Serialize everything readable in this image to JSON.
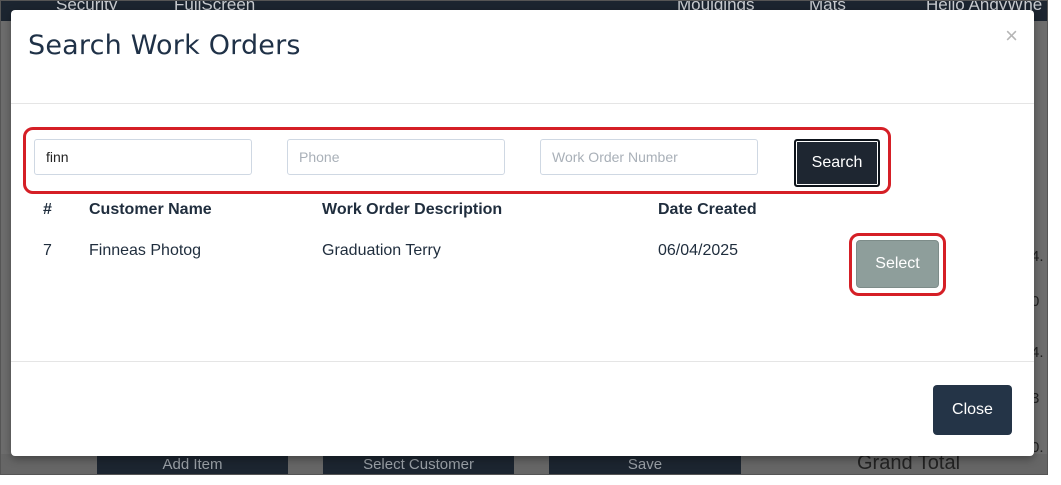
{
  "background": {
    "topbar_items": [
      "Security",
      "FullScreen",
      "Mouldings",
      "Mats",
      "Hello AndyWhe"
    ],
    "right_column_values": [
      "4.",
      "0",
      "4.",
      "3",
      "0."
    ],
    "bottom_buttons": [
      "Add Item",
      "Select Customer",
      "Save"
    ],
    "grand_total_label": "Grand Total"
  },
  "modal": {
    "title": "Search Work Orders",
    "close_x": "×",
    "search": {
      "name_value": "finn",
      "name_placeholder": "",
      "phone_value": "",
      "phone_placeholder": "Phone",
      "work_order_value": "",
      "work_order_placeholder": "Work Order Number",
      "search_label": "Search"
    },
    "table": {
      "headers": [
        "#",
        "Customer Name",
        "Work Order Description",
        "Date Created"
      ],
      "rows": [
        {
          "num": "7",
          "customer": "Finneas Photog",
          "description": "Graduation Terry",
          "date": "06/04/2025",
          "action_label": "Select"
        }
      ]
    },
    "footer": {
      "close_label": "Close"
    }
  },
  "colors": {
    "title": "#1f3147",
    "search_button": "#1e2631",
    "select_button": "#8e9e9b",
    "close_button": "#243447",
    "highlight": "#d51f26"
  }
}
